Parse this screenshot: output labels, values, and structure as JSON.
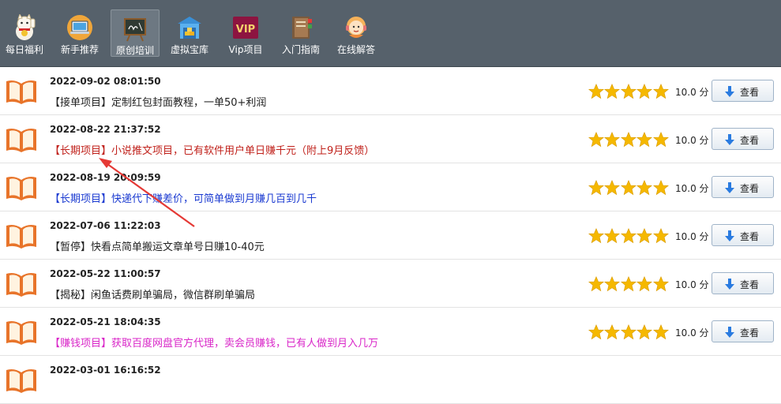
{
  "toolbar": {
    "items": [
      {
        "label": "每日福利",
        "icon": "lucky-cat-icon"
      },
      {
        "label": "新手推荐",
        "icon": "laptop-icon"
      },
      {
        "label": "原创培训",
        "icon": "blackboard-icon"
      },
      {
        "label": "虚拟宝库",
        "icon": "treasure-warehouse-icon"
      },
      {
        "label": "Vip项目",
        "icon": "vip-badge-icon"
      },
      {
        "label": "入门指南",
        "icon": "book-stack-icon"
      },
      {
        "label": "在线解答",
        "icon": "support-agent-icon"
      }
    ]
  },
  "rows": [
    {
      "date": "2022-09-02 08:01:50",
      "title": "【接单项目】定制红包封面教程，一单50+利润",
      "color": "#222222",
      "score": "10.0 分",
      "rating": 5,
      "button": "查看"
    },
    {
      "date": "2022-08-22 21:37:52",
      "title": "【长期项目】小说推文项目，已有软件用户单日赚千元（附上9月反馈）",
      "color": "#c0211b",
      "score": "10.0 分",
      "rating": 5,
      "button": "查看"
    },
    {
      "date": "2022-08-19 20:09:59",
      "title": "【长期项目】快递代下赚差价，可简单做到月赚几百到几千",
      "color": "#1a3ad1",
      "score": "10.0 分",
      "rating": 5,
      "button": "查看"
    },
    {
      "date": "2022-07-06 11:22:03",
      "title": "【暂停】快看点简单搬运文章单号日赚10-40元",
      "color": "#222222",
      "score": "10.0 分",
      "rating": 5,
      "button": "查看"
    },
    {
      "date": "2022-05-22 11:00:57",
      "title": "【揭秘】闲鱼话费刷单骗局，微信群刷单骗局",
      "color": "#222222",
      "score": "10.0 分",
      "rating": 5,
      "button": "查看"
    },
    {
      "date": "2022-05-21 18:04:35",
      "title": "【赚钱项目】获取百度网盘官方代理，卖会员赚钱，已有人做到月入几万",
      "color": "#d926c8",
      "score": "10.0 分",
      "rating": 5,
      "button": "查看"
    },
    {
      "date": "2022-03-01 16:16:52",
      "title": "",
      "color": "#222222",
      "score": "",
      "rating": 0,
      "button": ""
    }
  ],
  "colors": {
    "toolbar": "#56616b",
    "star": "#f5b800",
    "book": "#e8742a",
    "annotation_arrow": "#e53935"
  }
}
